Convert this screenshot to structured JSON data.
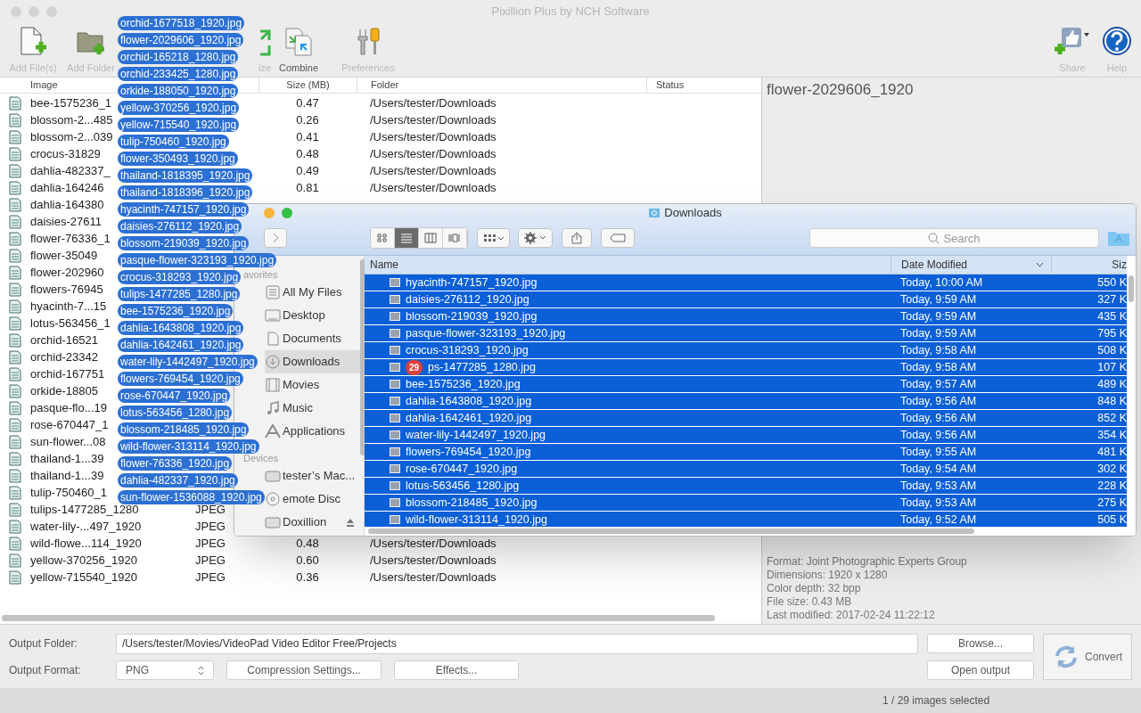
{
  "window": {
    "title": "Pixillion Plus by NCH Software"
  },
  "toolbar": [
    {
      "kind": "add-file",
      "label": "Add File(s)",
      "disabled": true
    },
    {
      "kind": "add-folder",
      "label": "Add Folder",
      "disabled": true
    },
    {
      "kind": "resize",
      "label": "ize",
      "disabled": true
    },
    {
      "kind": "combine",
      "label": "Combine",
      "disabled": false
    },
    {
      "kind": "preferences",
      "label": "Preferences",
      "disabled": true
    }
  ],
  "toolbar_right": [
    {
      "kind": "share",
      "label": "Share",
      "disabled": true
    },
    {
      "kind": "help",
      "label": "Help",
      "disabled": true
    }
  ],
  "file_list": {
    "columns": [
      "Image",
      "Size (MB)",
      "Folder",
      "Status"
    ],
    "rows": [
      {
        "name": "bee-1575236_1",
        "size": "0.47",
        "folder": "/Users/tester/Downloads"
      },
      {
        "name": "blossom-2...485",
        "size": "0.26",
        "folder": "/Users/tester/Downloads"
      },
      {
        "name": "blossom-2...039",
        "size": "0.41",
        "folder": "/Users/tester/Downloads"
      },
      {
        "name": "crocus-31829",
        "size": "0.48",
        "folder": "/Users/tester/Downloads"
      },
      {
        "name": "dahlia-482337_",
        "size": "0.49",
        "folder": "/Users/tester/Downloads"
      },
      {
        "name": "dahlia-164246",
        "size": "0.81",
        "folder": "/Users/tester/Downloads"
      },
      {
        "name": "dahlia-164380"
      },
      {
        "name": "daisies-27611"
      },
      {
        "name": "flower-76336_1"
      },
      {
        "name": "flower-35049"
      },
      {
        "name": "flower-202960"
      },
      {
        "name": "flowers-76945"
      },
      {
        "name": "hyacinth-7...15"
      },
      {
        "name": "lotus-563456_1"
      },
      {
        "name": "orchid-16521"
      },
      {
        "name": "orchid-23342"
      },
      {
        "name": "orchid-167751"
      },
      {
        "name": "orkide-18805"
      },
      {
        "name": "pasque-flo...19"
      },
      {
        "name": "rose-670447_1"
      },
      {
        "name": "sun-flower...08"
      },
      {
        "name": "thailand-1...39"
      },
      {
        "name": "thailand-1...39"
      },
      {
        "name": "tulip-750460_1"
      },
      {
        "name": "tulips-1477285_1280",
        "type": "JPEG"
      },
      {
        "name": "water-lily-...497_1920",
        "type": "JPEG"
      },
      {
        "name": "wild-flowe...114_1920",
        "type": "JPEG",
        "size": "0.48",
        "folder": "/Users/tester/Downloads"
      },
      {
        "name": "yellow-370256_1920",
        "type": "JPEG",
        "size": "0.60",
        "folder": "/Users/tester/Downloads"
      },
      {
        "name": "yellow-715540_1920",
        "type": "JPEG",
        "size": "0.36",
        "folder": "/Users/tester/Downloads"
      }
    ]
  },
  "preview": {
    "title": "flower-2029606_1920",
    "info": [
      "Format: Joint Photographic Experts Group",
      "Dimensions: 1920 x 1280",
      "Color depth: 32 bpp",
      "File size: 0.43 MB",
      "Last modified: 2017-02-24 11:22:12"
    ]
  },
  "output": {
    "folder_label": "Output Folder:",
    "folder": "/Users/tester/Movies/VideoPad Video Editor Free/Projects",
    "browse": "Browse...",
    "convert": "Convert",
    "format_label": "Output Format:",
    "format": "PNG",
    "compression": "Compression Settings...",
    "effects": "Effects...",
    "open_output": "Open output"
  },
  "status_bar": "1 / 29 images selected",
  "finder": {
    "title": "Downloads",
    "view_modes": [
      {
        "selected": false
      },
      {
        "selected": true
      },
      {
        "selected": false
      },
      {
        "selected": false
      }
    ],
    "search": {
      "placeholder": "Search"
    },
    "sidebar": [
      {
        "header": "avorites",
        "items": [
          {
            "kind": "all-files",
            "label": "All My Files",
            "selected": false,
            "ejectable": false
          },
          {
            "kind": "desktop",
            "label": "Desktop",
            "selected": false,
            "ejectable": false
          },
          {
            "kind": "documents",
            "label": "Documents",
            "selected": false,
            "ejectable": false
          },
          {
            "kind": "downloads",
            "label": "Downloads",
            "selected": true,
            "ejectable": false
          },
          {
            "kind": "movies",
            "label": "Movies",
            "selected": false,
            "ejectable": false
          },
          {
            "kind": "music",
            "label": "Music",
            "selected": false,
            "ejectable": false
          },
          {
            "kind": "applications",
            "label": "Applications",
            "selected": false,
            "ejectable": false
          }
        ]
      },
      {
        "header": "Devices",
        "items": [
          {
            "kind": "drive",
            "label": "tester’s Mac...",
            "selected": false,
            "ejectable": false
          },
          {
            "kind": "disc",
            "label": "emote Disc",
            "selected": false,
            "ejectable": false
          },
          {
            "kind": "drive",
            "label": "Doxillion",
            "selected": false,
            "ejectable": true
          }
        ]
      }
    ],
    "columns": [
      "Name",
      "Date Modified",
      "Siz"
    ],
    "rows": [
      {
        "name": "hyacinth-747157_1920.jpg",
        "date": "Today, 10:00 AM",
        "size": "550 K",
        "selected": true
      },
      {
        "name": "daisies-276112_1920.jpg",
        "date": "Today, 9:59 AM",
        "size": "327 K",
        "selected": true
      },
      {
        "name": "blossom-219039_1920.jpg",
        "date": "Today, 9:59 AM",
        "size": "435 K",
        "selected": true
      },
      {
        "name": "pasque-flower-323193_1920.jpg",
        "date": "Today, 9:59 AM",
        "size": "795 K",
        "selected": true
      },
      {
        "name": "crocus-318293_1920.jpg",
        "date": "Today, 9:58 AM",
        "size": "508 K",
        "selected": true
      },
      {
        "name": "ps-1477285_1280.jpg",
        "date": "Today, 9:58 AM",
        "size": "107 K",
        "selected": true,
        "badge": "29"
      },
      {
        "name": "bee-1575236_1920.jpg",
        "date": "Today, 9:57 AM",
        "size": "489 K",
        "selected": true
      },
      {
        "name": "dahlia-1643808_1920.jpg",
        "date": "Today, 9:56 AM",
        "size": "848 K",
        "selected": true
      },
      {
        "name": "dahlia-1642461_1920.jpg",
        "date": "Today, 9:56 AM",
        "size": "852 K",
        "selected": true
      },
      {
        "name": "water-lily-1442497_1920.jpg",
        "date": "Today, 9:56 AM",
        "size": "354 K",
        "selected": true
      },
      {
        "name": "flowers-769454_1920.jpg",
        "date": "Today, 9:55 AM",
        "size": "481 K",
        "selected": true
      },
      {
        "name": "rose-670447_1920.jpg",
        "date": "Today, 9:54 AM",
        "size": "302 K",
        "selected": true
      },
      {
        "name": "lotus-563456_1280.jpg",
        "date": "Today, 9:53 AM",
        "size": "228 K",
        "selected": true
      },
      {
        "name": "blossom-218485_1920.jpg",
        "date": "Today, 9:53 AM",
        "size": "275 K",
        "selected": true
      },
      {
        "name": "wild-flower-313114_1920.jpg",
        "date": "Today, 9:52 AM",
        "size": "505 K",
        "selected": true
      }
    ]
  },
  "drag_items": [
    "orchid-1677518_1920.jpg",
    "flower-2029606_1920.jpg",
    "orchid-165218_1280.jpg",
    "orchid-233425_1280.jpg",
    "orkide-188050_1920.jpg",
    "yellow-370256_1920.jpg",
    "yellow-715540_1920.jpg",
    "tulip-750460_1920.jpg",
    "flower-350493_1920.jpg",
    "thailand-1818395_1920.jpg",
    "thailand-1818396_1920.jpg",
    "hyacinth-747157_1920.jpg",
    "daisies-276112_1920.jpg",
    "blossom-219039_1920.jpg",
    "pasque-flower-323193_1920.jpg",
    "crocus-318293_1920.jpg",
    "tulips-1477285_1280.jpg",
    "bee-1575236_1920.jpg",
    "dahlia-1643808_1920.jpg",
    "dahlia-1642461_1920.jpg",
    "water-lily-1442497_1920.jpg",
    "flowers-769454_1920.jpg",
    "rose-670447_1920.jpg",
    "lotus-563456_1280.jpg",
    "blossom-218485_1920.jpg",
    "wild-flower-313114_1920.jpg",
    "flower-76336_1920.jpg",
    "dahlia-482337_1920.jpg",
    "sun-flower-1536088_1920.jpg"
  ]
}
